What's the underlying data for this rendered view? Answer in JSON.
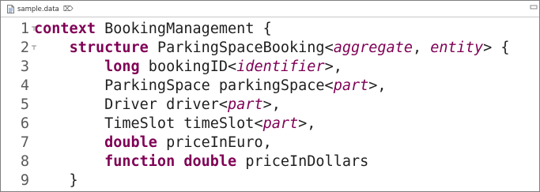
{
  "tab": {
    "title": "sample.data",
    "close_glyph": "⌦",
    "icon": "file-icon"
  },
  "editor": {
    "lines": [
      {
        "number": "1",
        "folded": true,
        "tokens": [
          {
            "t": "context",
            "c": "kw"
          },
          {
            "t": " BookingManagement {",
            "c": "tx"
          }
        ]
      },
      {
        "number": "2",
        "folded": true,
        "tokens": [
          {
            "t": "    ",
            "c": "tx"
          },
          {
            "t": "structure",
            "c": "kw"
          },
          {
            "t": " ParkingSpaceBooking<",
            "c": "tx"
          },
          {
            "t": "aggregate",
            "c": "tp"
          },
          {
            "t": ", ",
            "c": "tx"
          },
          {
            "t": "entity",
            "c": "tp"
          },
          {
            "t": "> {",
            "c": "tx"
          }
        ]
      },
      {
        "number": "3",
        "folded": false,
        "tokens": [
          {
            "t": "        ",
            "c": "tx"
          },
          {
            "t": "long",
            "c": "kw"
          },
          {
            "t": " bookingID<",
            "c": "tx"
          },
          {
            "t": "identifier",
            "c": "tp"
          },
          {
            "t": ">,",
            "c": "tx"
          }
        ]
      },
      {
        "number": "4",
        "folded": false,
        "tokens": [
          {
            "t": "        ParkingSpace parkingSpace<",
            "c": "tx"
          },
          {
            "t": "part",
            "c": "tp"
          },
          {
            "t": ">,",
            "c": "tx"
          }
        ]
      },
      {
        "number": "5",
        "folded": false,
        "tokens": [
          {
            "t": "        Driver driver<",
            "c": "tx"
          },
          {
            "t": "part",
            "c": "tp"
          },
          {
            "t": ">,",
            "c": "tx"
          }
        ]
      },
      {
        "number": "6",
        "folded": false,
        "tokens": [
          {
            "t": "        TimeSlot timeSlot<",
            "c": "tx"
          },
          {
            "t": "part",
            "c": "tp"
          },
          {
            "t": ">,",
            "c": "tx"
          }
        ]
      },
      {
        "number": "7",
        "folded": false,
        "tokens": [
          {
            "t": "        ",
            "c": "tx"
          },
          {
            "t": "double",
            "c": "kw"
          },
          {
            "t": " priceInEuro,",
            "c": "tx"
          }
        ]
      },
      {
        "number": "8",
        "folded": false,
        "tokens": [
          {
            "t": "        ",
            "c": "tx"
          },
          {
            "t": "function",
            "c": "kw"
          },
          {
            "t": " ",
            "c": "tx"
          },
          {
            "t": "double",
            "c": "kw"
          },
          {
            "t": " priceInDollars",
            "c": "tx"
          }
        ]
      },
      {
        "number": "9",
        "folded": false,
        "tokens": [
          {
            "t": "    }",
            "c": "tx"
          }
        ]
      }
    ]
  },
  "colors": {
    "keyword": "#7f0055",
    "text": "#1f1f1f",
    "line_number": "#5a5a5a"
  }
}
